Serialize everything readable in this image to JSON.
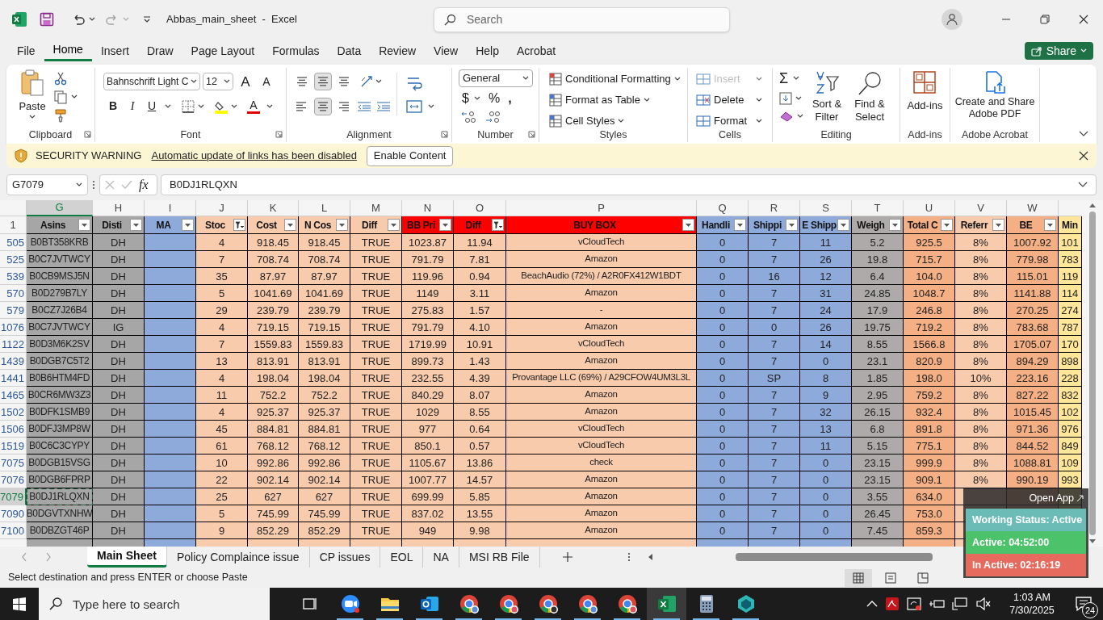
{
  "window": {
    "title": "Abbas_main_sheet  -  Excel",
    "search_placeholder": "Search"
  },
  "menu_tabs": [
    {
      "label": "File",
      "selected": false
    },
    {
      "label": "Home",
      "selected": true
    },
    {
      "label": "Insert",
      "selected": false
    },
    {
      "label": "Draw",
      "selected": false
    },
    {
      "label": "Page Layout",
      "selected": false
    },
    {
      "label": "Formulas",
      "selected": false
    },
    {
      "label": "Data",
      "selected": false
    },
    {
      "label": "Review",
      "selected": false
    },
    {
      "label": "View",
      "selected": false
    },
    {
      "label": "Help",
      "selected": false
    },
    {
      "label": "Acrobat",
      "selected": false
    }
  ],
  "share_button": "Share",
  "ribbon": {
    "groups": [
      {
        "kind": "clipboard",
        "label": "Clipboard",
        "paste": "Paste"
      },
      {
        "kind": "font",
        "label": "Font",
        "font_name": "Bahnschrift Light C",
        "font_size": "12",
        "grow": "A",
        "shrink": "A",
        "bold": "B",
        "italic": "I",
        "underline": "U",
        "font_color": "A"
      },
      {
        "kind": "alignment",
        "label": "Alignment"
      },
      {
        "kind": "number",
        "label": "Number",
        "format": "General",
        "currency": "$",
        "percent": "%",
        "comma": ","
      },
      {
        "kind": "styles",
        "label": "Styles",
        "items": [
          "Conditional Formatting",
          "Format as Table",
          "Cell Styles"
        ]
      },
      {
        "kind": "cells",
        "label": "Cells",
        "items": [
          {
            "label": "Insert",
            "disabled": true
          },
          {
            "label": "Delete",
            "disabled": false
          },
          {
            "label": "Format",
            "disabled": false
          }
        ]
      },
      {
        "kind": "editing",
        "label": "Editing",
        "sum": "Σ",
        "sort": "Sort & Filter",
        "find": "Find & Select"
      },
      {
        "kind": "addins",
        "label": "Add-ins",
        "button": "Add-ins"
      },
      {
        "kind": "acrobat",
        "label": "Adobe Acrobat",
        "button": "Create and Share Adobe PDF"
      }
    ]
  },
  "security_bar": {
    "title": "SECURITY WARNING",
    "message": "Automatic update of links has been disabled",
    "button": "Enable Content"
  },
  "formula_bar": {
    "name_box": "G7079",
    "fx": "fx",
    "value": "B0DJ1RLQXN"
  },
  "columns": [
    {
      "letter": "G",
      "header": {
        "text": "Asins",
        "color": "#a6a6a6"
      },
      "color": "#a6a6a6",
      "filtered": false,
      "selected": true
    },
    {
      "letter": "H",
      "header": {
        "text": "Disti",
        "color": "#a6a6a6"
      },
      "color": "#a6a6a6",
      "filtered": false,
      "selected": false
    },
    {
      "letter": "I",
      "header": {
        "text": "MA",
        "color": "#8eaadb"
      },
      "color": "#8eaadb",
      "filtered": false,
      "selected": false
    },
    {
      "letter": "J",
      "header": {
        "text": "Stoc",
        "color": "#f8cbad"
      },
      "color": "#f8cbad",
      "filtered": true,
      "selected": false
    },
    {
      "letter": "K",
      "header": {
        "text": "Cost",
        "color": "#f8cbad"
      },
      "color": "#f8cbad",
      "filtered": false,
      "selected": false
    },
    {
      "letter": "L",
      "header": {
        "text": "N Cos",
        "color": "#f8cbad"
      },
      "color": "#f8cbad",
      "filtered": false,
      "selected": false
    },
    {
      "letter": "M",
      "header": {
        "text": "Diff",
        "color": "#f8cbad"
      },
      "color": "#f8cbad",
      "filtered": false,
      "selected": false
    },
    {
      "letter": "N",
      "header": {
        "text": "BB Pri",
        "color": "#ff0000"
      },
      "color": "#f8cbad",
      "filtered": false,
      "selected": false
    },
    {
      "letter": "O",
      "header": {
        "text": "Diff",
        "color": "#ff0000"
      },
      "color": "#f8cbad",
      "filtered": true,
      "selected": false
    },
    {
      "letter": "P",
      "header": {
        "text": "BUY BOX",
        "color": "#ff0000"
      },
      "color": "#f8cbad",
      "filtered": false,
      "selected": false
    },
    {
      "letter": "Q",
      "header": {
        "text": "Handli",
        "color": "#8eaadb"
      },
      "color": "#8eaadb",
      "filtered": false,
      "selected": false
    },
    {
      "letter": "R",
      "header": {
        "text": "Shippi",
        "color": "#8eaadb"
      },
      "color": "#8eaadb",
      "filtered": false,
      "selected": false
    },
    {
      "letter": "S",
      "header": {
        "text": "E Shipp",
        "color": "#8eaadb"
      },
      "color": "#8eaadb",
      "filtered": false,
      "selected": false
    },
    {
      "letter": "T",
      "header": {
        "text": "Weigh",
        "color": "#aeaaaa"
      },
      "color": "#aeaaaa",
      "filtered": false,
      "selected": false
    },
    {
      "letter": "U",
      "header": {
        "text": "Total C",
        "color": "#f4b084"
      },
      "color": "#f4b084",
      "filtered": false,
      "selected": false
    },
    {
      "letter": "V",
      "header": {
        "text": "Referr",
        "color": "#f8cbad"
      },
      "color": "#f8cbad",
      "filtered": false,
      "selected": false
    },
    {
      "letter": "W",
      "header": {
        "text": "BE",
        "color": "#f4b084"
      },
      "color": "#f4b084",
      "filtered": false,
      "selected": false
    },
    {
      "header": {
        "text": "Min",
        "color": "#ffe699"
      },
      "color": "#ffe699"
    }
  ],
  "header_row_number": "1",
  "rows": [
    {
      "number": "505",
      "selected": false,
      "cells": [
        "B0BT358KRB",
        "DH",
        null,
        "4",
        "918.45",
        "918.45",
        "TRUE",
        "1023.87",
        "11.94",
        "vCloudTech",
        "0",
        "7",
        "11",
        "5.2",
        "925.5",
        "8%",
        "1007.92",
        "101"
      ]
    },
    {
      "number": "525",
      "selected": false,
      "cells": [
        "B0C7JVTWCY",
        "DH",
        null,
        "7",
        "708.74",
        "708.74",
        "TRUE",
        "791.79",
        "7.81",
        "Amazon",
        "0",
        "7",
        "26",
        "19.8",
        "715.7",
        "8%",
        "779.98",
        "783"
      ]
    },
    {
      "number": "539",
      "selected": false,
      "cells": [
        "B0CB9MSJ5N",
        "DH",
        null,
        "35",
        "87.97",
        "87.97",
        "TRUE",
        "119.96",
        "0.94",
        "BeachAudio (72%) / A2R0FX412W1BDT",
        "0",
        "16",
        "12",
        "6.4",
        "104.0",
        "8%",
        "115.01",
        "119"
      ]
    },
    {
      "number": "570",
      "selected": false,
      "cells": [
        "B0D279B7LY",
        "DH",
        null,
        "5",
        "1041.69",
        "1041.69",
        "TRUE",
        "1149",
        "3.11",
        "Amazon",
        "0",
        "7",
        "31",
        "24.85",
        "1048.7",
        "8%",
        "1141.88",
        "114"
      ]
    },
    {
      "number": "579",
      "selected": false,
      "cells": [
        "B0CZ7J26B4",
        "DH",
        null,
        "29",
        "239.79",
        "239.79",
        "TRUE",
        "275.83",
        "1.57",
        "-",
        "0",
        "7",
        "24",
        "17.9",
        "246.8",
        "8%",
        "270.25",
        "274"
      ]
    },
    {
      "number": "1076",
      "selected": false,
      "cells": [
        "B0C7JVTWCY",
        "IG",
        null,
        "4",
        "719.15",
        "719.15",
        "TRUE",
        "791.79",
        "4.10",
        "Amazon",
        "0",
        "0",
        "26",
        "19.75",
        "719.2",
        "8%",
        "783.68",
        "787"
      ]
    },
    {
      "number": "1122",
      "selected": false,
      "cells": [
        "B0D3M6K2SV",
        "DH",
        null,
        "7",
        "1559.83",
        "1559.83",
        "TRUE",
        "1719.99",
        "10.91",
        "vCloudTech",
        "0",
        "7",
        "14",
        "8.55",
        "1566.8",
        "8%",
        "1705.07",
        "170"
      ]
    },
    {
      "number": "1439",
      "selected": false,
      "cells": [
        "B0DGB7C5T2",
        "DH",
        null,
        "13",
        "813.91",
        "813.91",
        "TRUE",
        "899.73",
        "1.43",
        "Amazon",
        "0",
        "7",
        "0",
        "23.1",
        "820.9",
        "8%",
        "894.29",
        "898"
      ]
    },
    {
      "number": "1441",
      "selected": false,
      "cells": [
        "B0B6HTM4FD",
        "DH",
        null,
        "4",
        "198.04",
        "198.04",
        "TRUE",
        "232.55",
        "4.39",
        "Provantage LLC (69%) / A29CFOW4UM3L3L",
        "0",
        "SP",
        "8",
        "1.85",
        "198.0",
        "10%",
        "223.16",
        "228"
      ]
    },
    {
      "number": "1465",
      "selected": false,
      "cells": [
        "B0CR6MW3Z3",
        "DH",
        null,
        "11",
        "752.2",
        "752.2",
        "TRUE",
        "840.29",
        "8.07",
        "Amazon",
        "0",
        "7",
        "9",
        "2.95",
        "759.2",
        "8%",
        "827.22",
        "832"
      ]
    },
    {
      "number": "1502",
      "selected": false,
      "cells": [
        "B0DFK1SMB9",
        "DH",
        null,
        "4",
        "925.37",
        "925.37",
        "TRUE",
        "1029",
        "8.55",
        "Amazon",
        "0",
        "7",
        "32",
        "26.15",
        "932.4",
        "8%",
        "1015.45",
        "102"
      ]
    },
    {
      "number": "1506",
      "selected": false,
      "cells": [
        "B0DFJ3MP8W",
        "DH",
        null,
        "45",
        "884.81",
        "884.81",
        "TRUE",
        "977",
        "0.64",
        "vCloudTech",
        "0",
        "7",
        "13",
        "6.8",
        "891.8",
        "8%",
        "971.36",
        "976"
      ]
    },
    {
      "number": "1519",
      "selected": false,
      "cells": [
        "B0C6C3CYPY",
        "DH",
        null,
        "61",
        "768.12",
        "768.12",
        "TRUE",
        "850.1",
        "0.57",
        "vCloudTech",
        "0",
        "7",
        "11",
        "5.15",
        "775.1",
        "8%",
        "844.52",
        "849"
      ]
    },
    {
      "number": "7075",
      "selected": false,
      "cells": [
        "B0DGB15VSG",
        "DH",
        null,
        "10",
        "992.86",
        "992.86",
        "TRUE",
        "1105.67",
        "13.86",
        "check",
        "0",
        "7",
        "0",
        "23.15",
        "999.9",
        "8%",
        "1088.81",
        "109"
      ]
    },
    {
      "number": "7076",
      "selected": false,
      "cells": [
        "B0DGB6FPRP",
        "DH",
        null,
        "22",
        "902.14",
        "902.14",
        "TRUE",
        "1007.77",
        "14.57",
        "Amazon",
        "0",
        "7",
        "0",
        "23.15",
        "909.1",
        "8%",
        "990.19",
        "993"
      ]
    },
    {
      "number": "7079",
      "selected": true,
      "cells": [
        "B0DJ1RLQXN",
        "DH",
        null,
        "25",
        "627",
        "627",
        "TRUE",
        "699.99",
        "5.85",
        "Amazon",
        "0",
        "7",
        "0",
        "3.55",
        "634.0",
        null,
        null,
        null
      ]
    },
    {
      "number": "7090",
      "selected": false,
      "cells": [
        "B0DGVTXNHW",
        "DH",
        null,
        "5",
        "745.99",
        "745.99",
        "TRUE",
        "837.02",
        "13.55",
        "Amazon",
        "0",
        "7",
        "0",
        "26.45",
        "753.0",
        null,
        null,
        null
      ]
    },
    {
      "number": "7100",
      "selected": false,
      "cells": [
        "B0DBZGT46P",
        "DH",
        null,
        "9",
        "852.29",
        "852.29",
        "TRUE",
        "949",
        "9.98",
        "Amazon",
        "0",
        "7",
        "0",
        "7.45",
        "859.3",
        null,
        null,
        null
      ]
    }
  ],
  "sheet_tabs": [
    {
      "label": "Main Sheet",
      "selected": true
    },
    {
      "label": "Policy Complaince issue",
      "selected": false
    },
    {
      "label": "CP issues",
      "selected": false
    },
    {
      "label": "EOL",
      "selected": false
    },
    {
      "label": "NA",
      "selected": false
    },
    {
      "label": "MSI RB File",
      "selected": false
    }
  ],
  "status_bar": {
    "message": "Select destination and press ENTER or choose Paste"
  },
  "tracker_widget": {
    "open_app": "Open App",
    "status": "Working Status: Active",
    "active": "Active: 04:52:00",
    "inactive": "In Active: 02:16:19"
  },
  "taskbar": {
    "search_placeholder": "Type here to search",
    "time": "1:03 AM",
    "date": "7/30/2025",
    "notifications": "24"
  }
}
